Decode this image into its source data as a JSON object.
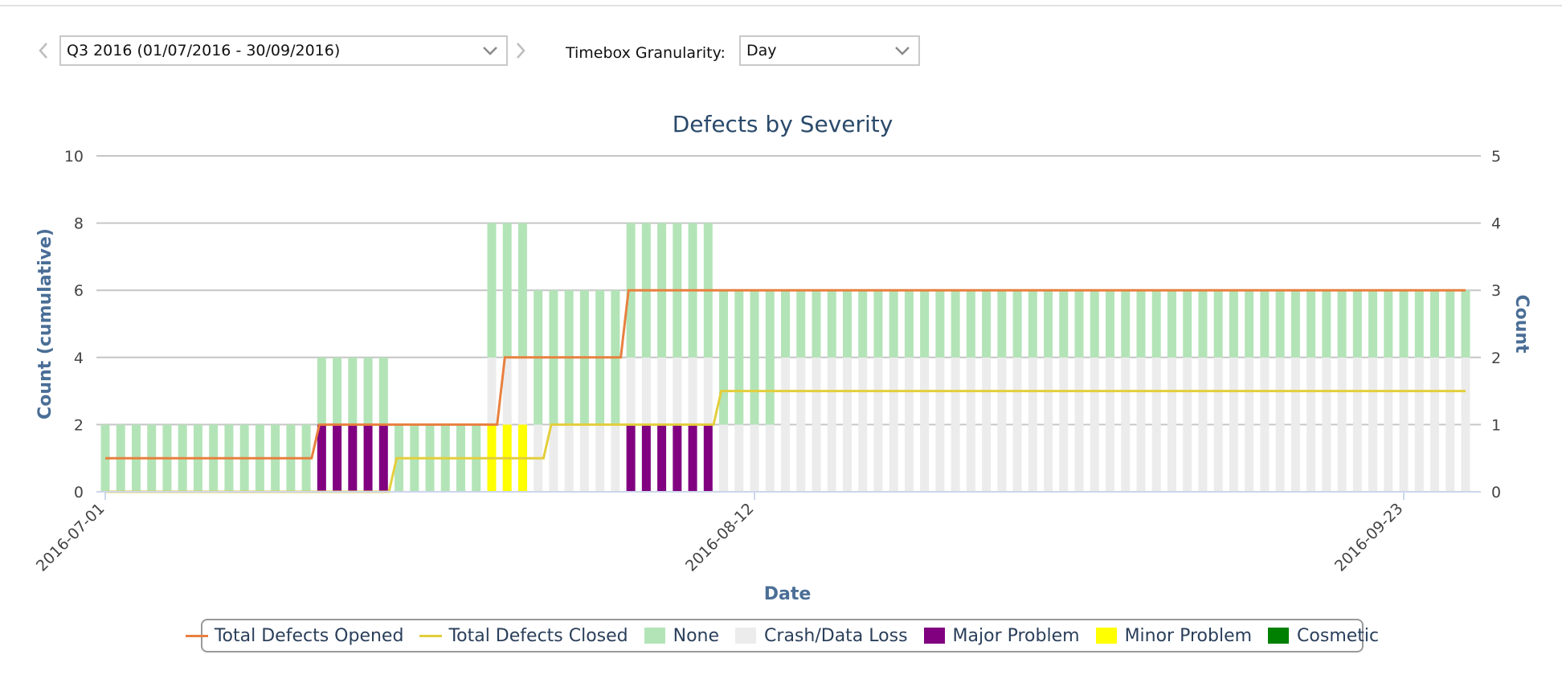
{
  "controls": {
    "quarter_value": "Q3 2016 (01/07/2016 - 30/09/2016)",
    "granularity_label": "Timebox Granularity:",
    "granularity_value": "Day"
  },
  "icons": {
    "prev": "chevron-left-icon",
    "next": "chevron-right-icon",
    "dropdown": "chevron-down-icon"
  },
  "colors": {
    "none": "#b3e4b7",
    "crash": "#ececec",
    "major": "#800080",
    "minor": "#ffff00",
    "cosmetic": "#008000",
    "opened": "#e8803f",
    "closed": "#e3ce3c"
  },
  "chart_data": {
    "type": "bar",
    "title": "Defects by Severity",
    "xlabel": "Date",
    "ylabel": "Count (cumulative)",
    "ylabel_right": "Count",
    "ylim": [
      0,
      10
    ],
    "ylim_right": [
      0,
      5
    ],
    "yticks": [
      "0",
      "2",
      "4",
      "6",
      "8",
      "10"
    ],
    "yticks_right": [
      "0",
      "1",
      "2",
      "3",
      "4",
      "5"
    ],
    "xtick_labels": [
      "2016-07-01",
      "2016-08-12",
      "2016-09-23"
    ],
    "stacked": true,
    "grid": true,
    "legend_position": "bottom",
    "series": [
      {
        "name": "Total Defects Opened",
        "kind": "line",
        "axis": "left",
        "values": [
          1,
          1,
          1,
          1,
          1,
          1,
          1,
          1,
          1,
          1,
          1,
          1,
          1,
          1,
          2,
          2,
          2,
          2,
          2,
          2,
          2,
          2,
          2,
          2,
          2,
          2,
          4,
          4,
          4,
          4,
          4,
          4,
          4,
          4,
          6,
          6,
          6,
          6,
          6,
          6,
          6,
          6,
          6,
          6,
          6,
          6,
          6,
          6,
          6,
          6,
          6,
          6,
          6,
          6,
          6,
          6,
          6,
          6,
          6,
          6,
          6,
          6,
          6,
          6,
          6,
          6,
          6,
          6,
          6,
          6,
          6,
          6,
          6,
          6,
          6,
          6,
          6,
          6,
          6,
          6,
          6,
          6,
          6,
          6,
          6,
          6,
          6,
          6,
          6
        ]
      },
      {
        "name": "Total Defects Closed",
        "kind": "line",
        "axis": "left",
        "values": [
          0,
          0,
          0,
          0,
          0,
          0,
          0,
          0,
          0,
          0,
          0,
          0,
          0,
          0,
          0,
          0,
          0,
          0,
          0,
          1,
          1,
          1,
          1,
          1,
          1,
          1,
          1,
          1,
          1,
          2,
          2,
          2,
          2,
          2,
          2,
          2,
          2,
          2,
          2,
          2,
          3,
          3,
          3,
          3,
          3,
          3,
          3,
          3,
          3,
          3,
          3,
          3,
          3,
          3,
          3,
          3,
          3,
          3,
          3,
          3,
          3,
          3,
          3,
          3,
          3,
          3,
          3,
          3,
          3,
          3,
          3,
          3,
          3,
          3,
          3,
          3,
          3,
          3,
          3,
          3,
          3,
          3,
          3,
          3,
          3,
          3,
          3,
          3,
          3
        ]
      },
      {
        "name": "None",
        "kind": "bar",
        "axis": "right",
        "values": [
          1,
          1,
          1,
          1,
          1,
          1,
          1,
          1,
          1,
          1,
          1,
          1,
          1,
          1,
          1,
          1,
          1,
          1,
          1,
          1,
          1,
          1,
          1,
          1,
          1,
          2,
          2,
          2,
          2,
          2,
          2,
          2,
          2,
          2,
          2,
          2,
          2,
          2,
          2,
          2,
          2,
          2,
          2,
          2,
          1,
          1,
          1,
          1,
          1,
          1,
          1,
          1,
          1,
          1,
          1,
          1,
          1,
          1,
          1,
          1,
          1,
          1,
          1,
          1,
          1,
          1,
          1,
          1,
          1,
          1,
          1,
          1,
          1,
          1,
          1,
          1,
          1,
          1,
          1,
          1,
          1,
          1,
          1,
          1,
          1,
          1,
          1,
          1,
          1
        ]
      },
      {
        "name": "Crash/Data Loss",
        "kind": "bar",
        "axis": "right",
        "values": [
          0,
          0,
          0,
          0,
          0,
          0,
          0,
          0,
          0,
          0,
          0,
          0,
          0,
          0,
          0,
          0,
          0,
          0,
          0,
          0,
          0,
          0,
          0,
          0,
          0,
          1,
          1,
          1,
          1,
          1,
          1,
          1,
          1,
          1,
          1,
          1,
          1,
          1,
          1,
          1,
          1,
          1,
          1,
          1,
          2,
          2,
          2,
          2,
          2,
          2,
          2,
          2,
          2,
          2,
          2,
          2,
          2,
          2,
          2,
          2,
          2,
          2,
          2,
          2,
          2,
          2,
          2,
          2,
          2,
          2,
          2,
          2,
          2,
          2,
          2,
          2,
          2,
          2,
          2,
          2,
          2,
          2,
          2,
          2,
          2,
          2,
          2,
          2,
          2
        ]
      },
      {
        "name": "Major Problem",
        "kind": "bar",
        "axis": "right",
        "values": [
          0,
          0,
          0,
          0,
          0,
          0,
          0,
          0,
          0,
          0,
          0,
          0,
          0,
          0,
          1,
          1,
          1,
          1,
          1,
          0,
          0,
          0,
          0,
          0,
          0,
          0,
          0,
          0,
          0,
          0,
          0,
          0,
          0,
          0,
          1,
          1,
          1,
          1,
          1,
          1,
          0,
          0,
          0,
          0,
          0,
          0,
          0,
          0,
          0,
          0,
          0,
          0,
          0,
          0,
          0,
          0,
          0,
          0,
          0,
          0,
          0,
          0,
          0,
          0,
          0,
          0,
          0,
          0,
          0,
          0,
          0,
          0,
          0,
          0,
          0,
          0,
          0,
          0,
          0,
          0,
          0,
          0,
          0,
          0,
          0,
          0,
          0,
          0,
          0
        ]
      },
      {
        "name": "Minor Problem",
        "kind": "bar",
        "axis": "right",
        "values": [
          0,
          0,
          0,
          0,
          0,
          0,
          0,
          0,
          0,
          0,
          0,
          0,
          0,
          0,
          0,
          0,
          0,
          0,
          0,
          0,
          0,
          0,
          0,
          0,
          0,
          1,
          1,
          1,
          0,
          0,
          0,
          0,
          0,
          0,
          0,
          0,
          0,
          0,
          0,
          0,
          0,
          0,
          0,
          0,
          0,
          0,
          0,
          0,
          0,
          0,
          0,
          0,
          0,
          0,
          0,
          0,
          0,
          0,
          0,
          0,
          0,
          0,
          0,
          0,
          0,
          0,
          0,
          0,
          0,
          0,
          0,
          0,
          0,
          0,
          0,
          0,
          0,
          0,
          0,
          0,
          0,
          0,
          0,
          0,
          0,
          0,
          0,
          0,
          0
        ]
      },
      {
        "name": "Cosmetic",
        "kind": "bar",
        "axis": "right",
        "values": [
          0,
          0,
          0,
          0,
          0,
          0,
          0,
          0,
          0,
          0,
          0,
          0,
          0,
          0,
          0,
          0,
          0,
          0,
          0,
          0,
          0,
          0,
          0,
          0,
          0,
          0,
          0,
          0,
          0,
          0,
          0,
          0,
          0,
          0,
          0,
          0,
          0,
          0,
          0,
          0,
          0,
          0,
          0,
          0,
          0,
          0,
          0,
          0,
          0,
          0,
          0,
          0,
          0,
          0,
          0,
          0,
          0,
          0,
          0,
          0,
          0,
          0,
          0,
          0,
          0,
          0,
          0,
          0,
          0,
          0,
          0,
          0,
          0,
          0,
          0,
          0,
          0,
          0,
          0,
          0,
          0,
          0,
          0,
          0,
          0,
          0,
          0,
          0,
          0
        ]
      }
    ]
  }
}
